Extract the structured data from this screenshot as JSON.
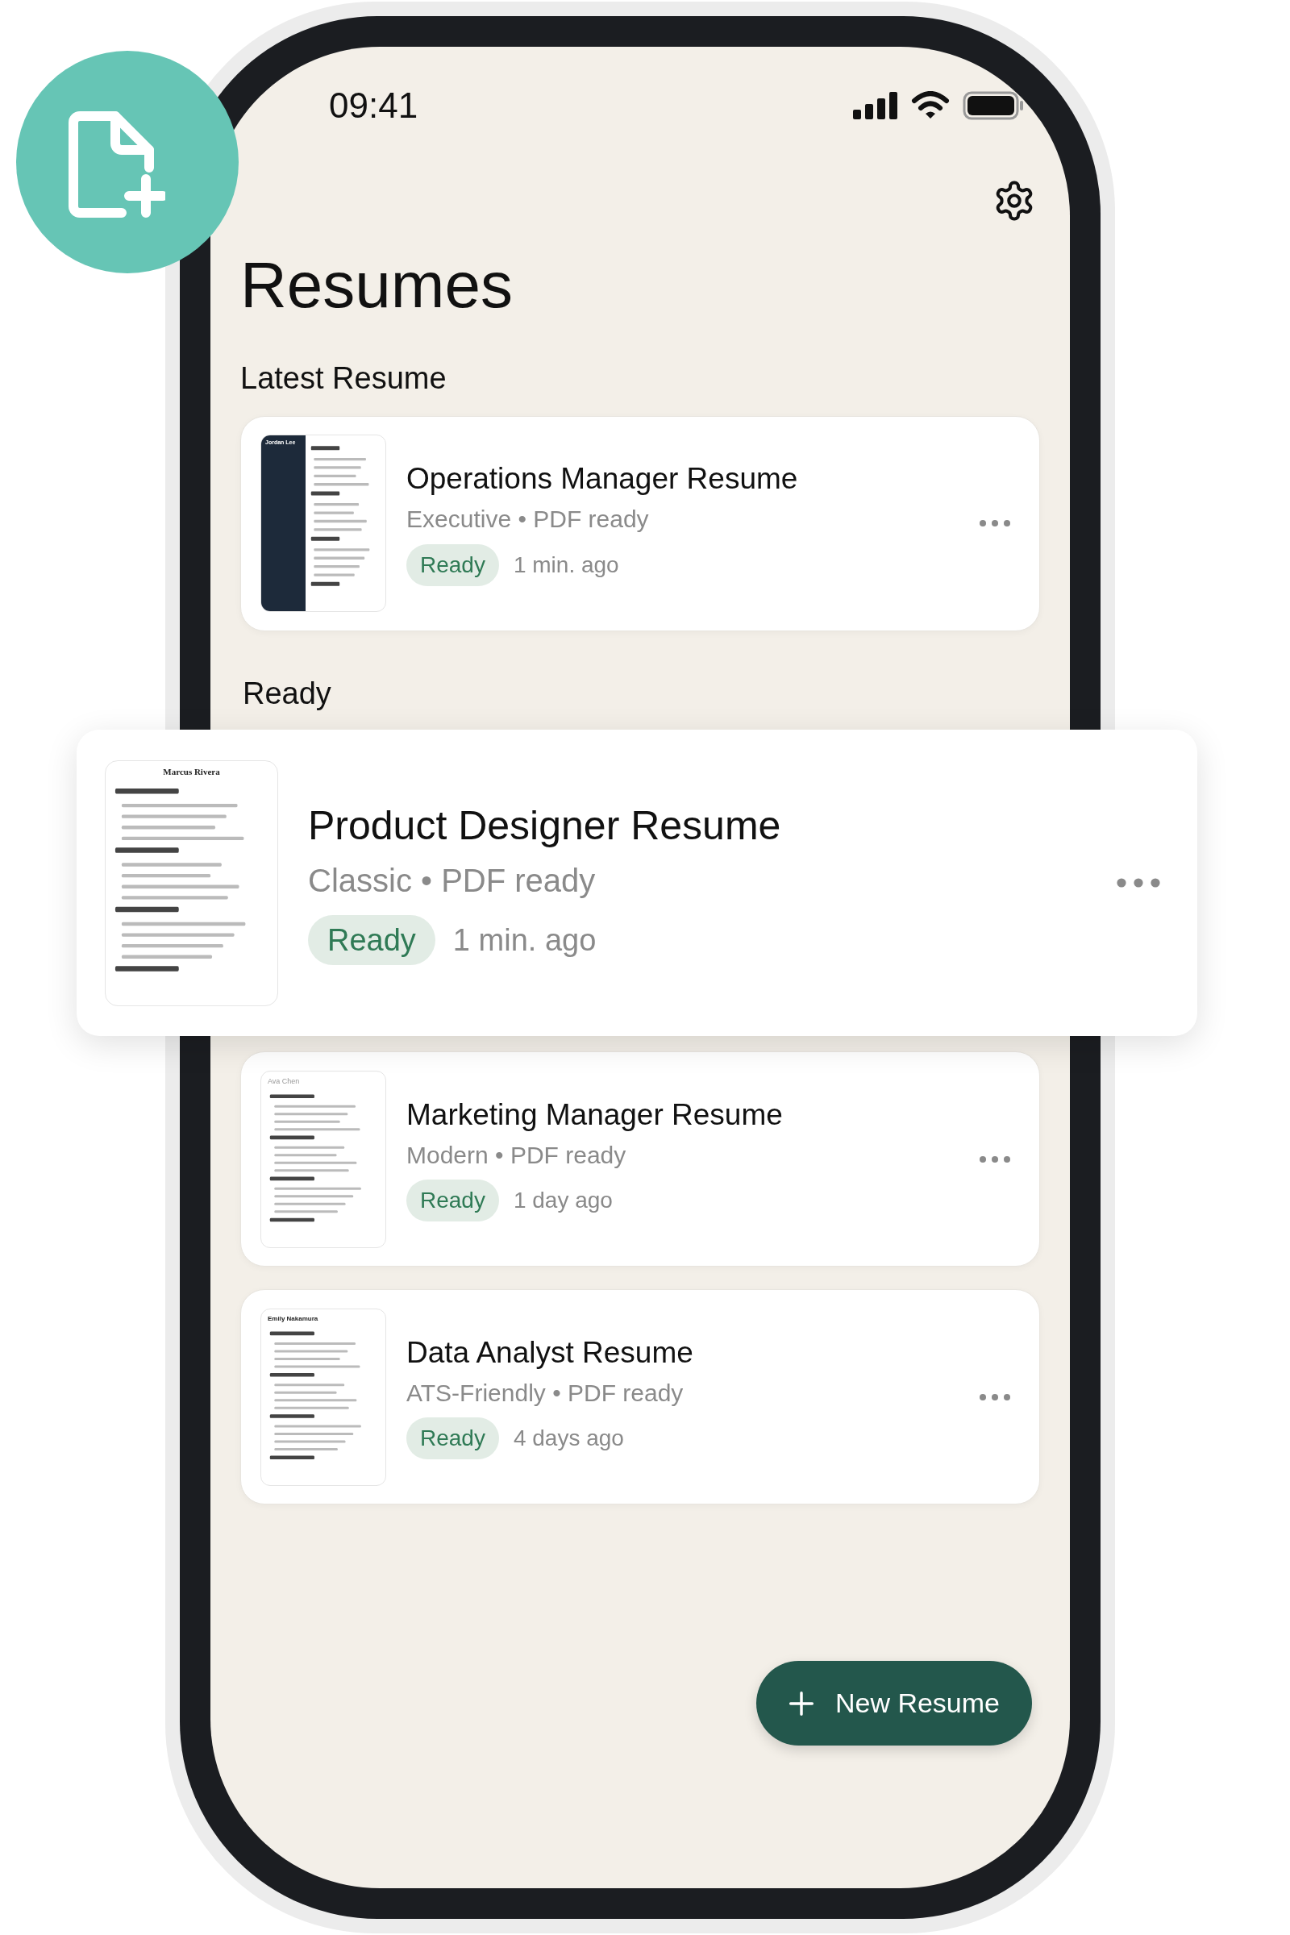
{
  "status_bar": {
    "time": "09:41"
  },
  "title": "Resumes",
  "latest": {
    "heading": "Latest Resume",
    "resumes": [
      {
        "title": "Operations Manager Resume",
        "meta": "Executive • PDF ready",
        "badge": "Ready",
        "time": "1 min. ago",
        "thumbnail": {
          "kind": "sidebar",
          "name": "Jordan Lee"
        }
      }
    ]
  },
  "ready": {
    "heading": "Ready",
    "resumes": [
      {
        "title": "Product Designer Resume",
        "meta": "Classic • PDF ready",
        "badge": "Ready",
        "time": "1 min. ago",
        "dragging": true,
        "thumbnail": {
          "kind": "serif",
          "name": "Marcus Rivera"
        }
      },
      {
        "title": "Marketing Manager Resume",
        "meta": "Modern • PDF ready",
        "badge": "Ready",
        "time": "1 day ago",
        "dragging": false,
        "thumbnail": {
          "kind": "light",
          "name": "Ava Chen"
        }
      },
      {
        "title": "Data Analyst Resume",
        "meta": "ATS-Friendly • PDF ready",
        "badge": "Ready",
        "time": "4 days ago",
        "dragging": false,
        "thumbnail": {
          "kind": "bold",
          "name": "Emily Nakamura"
        }
      }
    ]
  },
  "new_button": {
    "label": "New Resume"
  }
}
